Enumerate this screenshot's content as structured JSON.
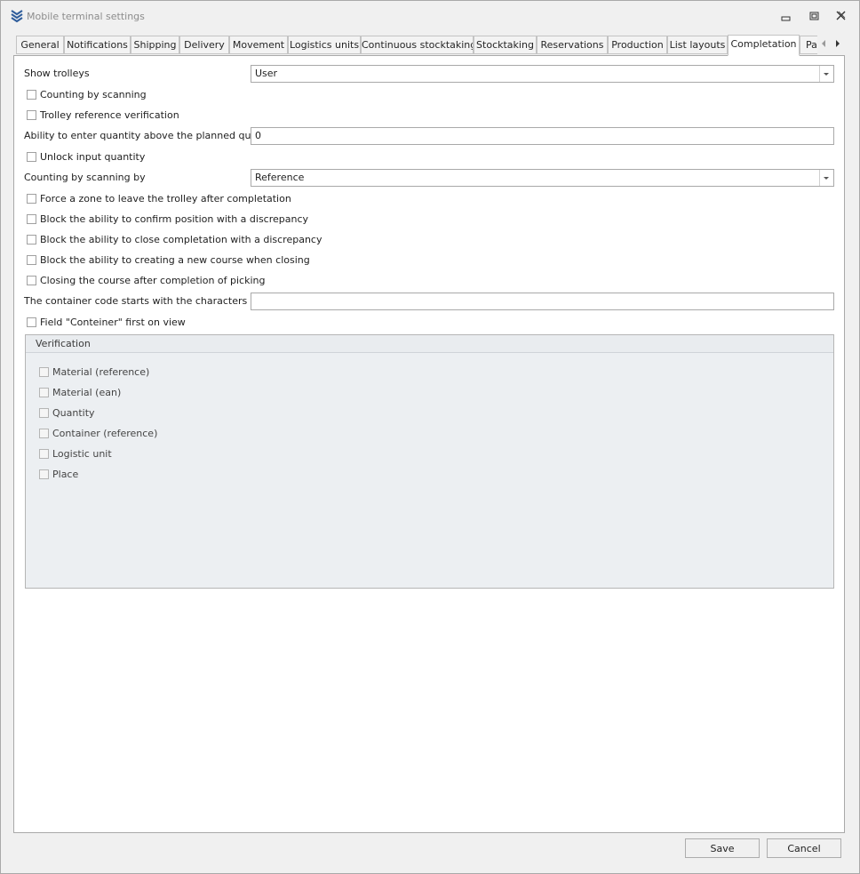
{
  "window": {
    "title": "Mobile terminal settings"
  },
  "tabs": [
    {
      "label": "General"
    },
    {
      "label": "Notifications"
    },
    {
      "label": "Shipping"
    },
    {
      "label": "Delivery"
    },
    {
      "label": "Movement"
    },
    {
      "label": "Logistics units"
    },
    {
      "label": "Continuous stocktaking"
    },
    {
      "label": "Stocktaking"
    },
    {
      "label": "Reservations"
    },
    {
      "label": "Production"
    },
    {
      "label": "List layouts"
    },
    {
      "label": "Completation",
      "active": true
    },
    {
      "label": "Pa"
    }
  ],
  "form": {
    "show_trolleys": {
      "label": "Show trolleys",
      "value": "User"
    },
    "counting_by_scanning": {
      "label": "Counting by scanning",
      "checked": false
    },
    "trolley_reference_verification": {
      "label": "Trolley reference verification",
      "checked": false
    },
    "quantity_above_planned": {
      "label": "Ability to enter quantity above the planned quantity",
      "value": "0"
    },
    "unlock_input_quantity": {
      "label": "Unlock input quantity",
      "checked": false
    },
    "counting_by_scanning_by": {
      "label": "Counting by scanning by",
      "value": "Reference"
    },
    "force_zone": {
      "label": "Force a zone to leave the trolley after completation",
      "checked": false
    },
    "block_confirm_position": {
      "label": "Block the ability to confirm position with a discrepancy",
      "checked": false
    },
    "block_close_completation": {
      "label": "Block the ability to close completation with a discrepancy",
      "checked": false
    },
    "block_new_course": {
      "label": "Block the ability to creating a new course when closing",
      "checked": false
    },
    "closing_course": {
      "label": "Closing the course after completion of picking",
      "checked": false
    },
    "container_code_prefix": {
      "label": "The container code starts with the characters",
      "value": ""
    },
    "field_container_first": {
      "label": "Field \"Conteiner\" first on view",
      "checked": false
    }
  },
  "verification": {
    "title": "Verification",
    "items": [
      {
        "label": "Material (reference)",
        "checked": false
      },
      {
        "label": "Material (ean)",
        "checked": false
      },
      {
        "label": "Quantity",
        "checked": false
      },
      {
        "label": "Container (reference)",
        "checked": false
      },
      {
        "label": "Logistic unit",
        "checked": false
      },
      {
        "label": "Place",
        "checked": false
      }
    ]
  },
  "footer": {
    "save_label": "Save",
    "cancel_label": "Cancel"
  },
  "icons": {
    "app": "chevrons-down-icon",
    "minimize": "minimize-icon",
    "restore": "restore-icon",
    "close": "close-icon",
    "tab_prev": "chevron-left-icon",
    "tab_next": "chevron-right-icon",
    "dropdown": "chevron-down-icon"
  },
  "colors": {
    "accent": "#2f5d9b",
    "panel_bg": "#ffffff",
    "group_bg": "#eceff2"
  }
}
